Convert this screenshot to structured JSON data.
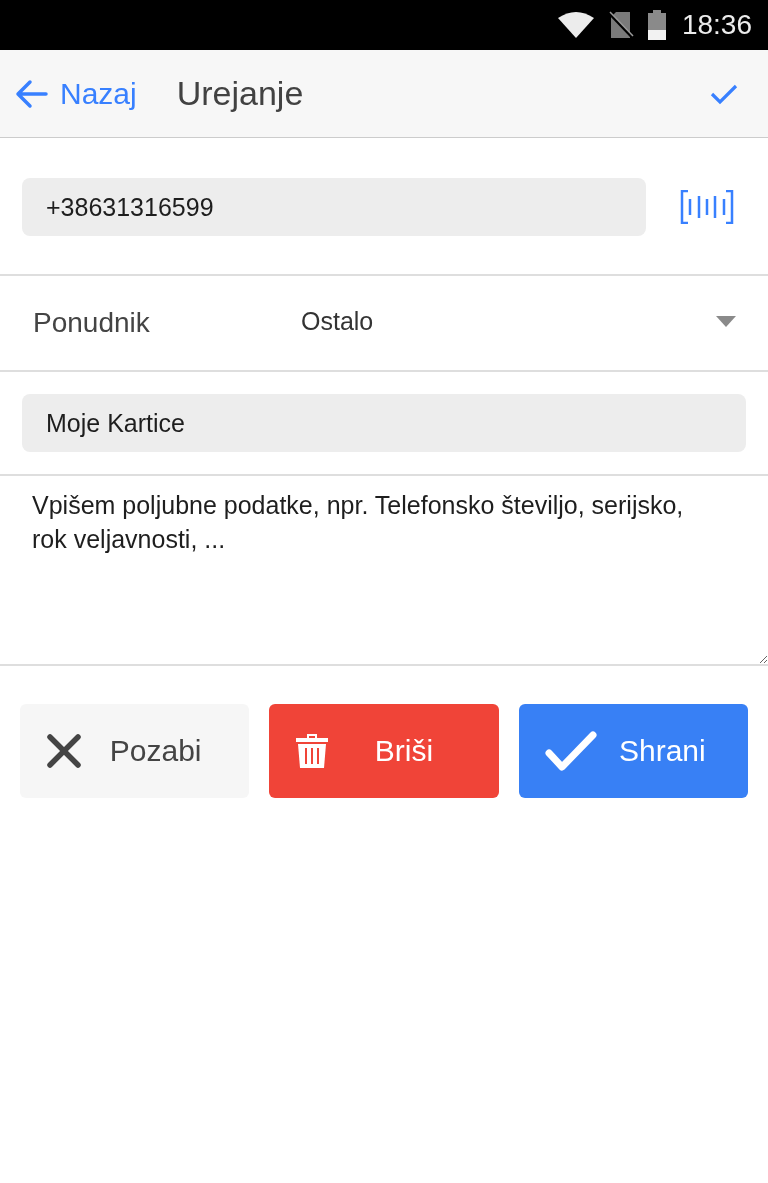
{
  "status_bar": {
    "time": "18:36"
  },
  "header": {
    "back_label": "Nazaj",
    "title": "Urejanje"
  },
  "number_field": {
    "value": "+38631316599"
  },
  "provider": {
    "label": "Ponudnik",
    "value": "Ostalo"
  },
  "name_field": {
    "value": "Moje Kartice"
  },
  "notes_field": {
    "value": "Vpišem poljubne podatke, npr. Telefonsko številjo, serijsko, rok veljavnosti, ..."
  },
  "buttons": [
    {
      "kind": "cancel",
      "label": "Pozabi"
    },
    {
      "kind": "delete",
      "label": "Briši"
    },
    {
      "kind": "save",
      "label": "Shrani"
    }
  ]
}
